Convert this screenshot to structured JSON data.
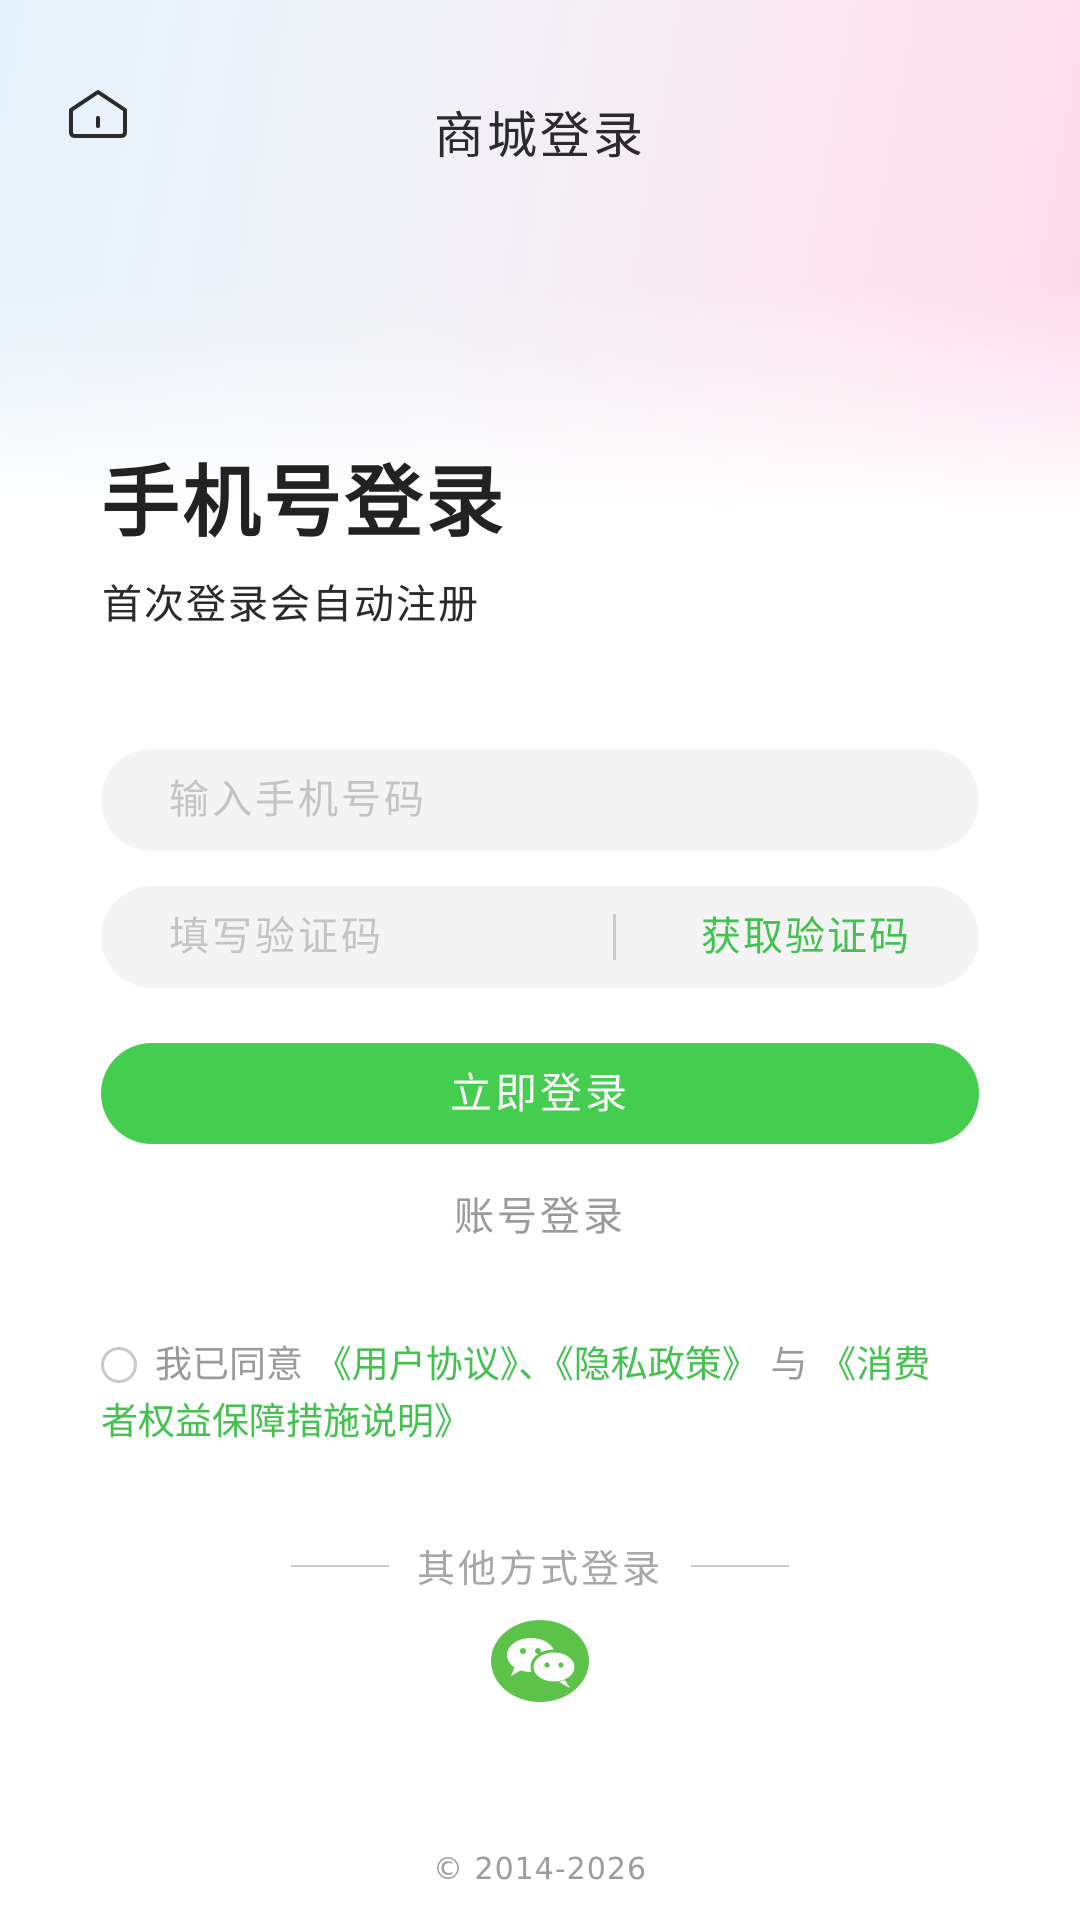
{
  "header": {
    "home_icon": "home-icon",
    "title": "商城登录"
  },
  "intro": {
    "heading": "手机号登录",
    "subheading": "首次登录会自动注册"
  },
  "form": {
    "phone_value": "",
    "phone_placeholder": "输入手机号码",
    "code_value": "",
    "code_placeholder": "填写验证码",
    "get_code_label": "获取验证码",
    "login_label": "立即登录",
    "account_login_label": "账号登录"
  },
  "agreement": {
    "checked": false,
    "prefix": "我已同意",
    "user_agreement": "《用户协议》",
    "separator": "、",
    "privacy_policy": "《隐私政策》",
    "conjunction": "与",
    "consumer_rights": "《消费者权益保障措施说明》"
  },
  "other_login": {
    "title": "其他方式登录",
    "wechat_icon": "wechat-icon"
  },
  "footer": {
    "copyright": "© 2014-2026"
  },
  "colors": {
    "accent": "#44cd4e",
    "link": "#44c24f",
    "wechat": "#5cc24a",
    "field_bg": "#f4f4f4"
  }
}
